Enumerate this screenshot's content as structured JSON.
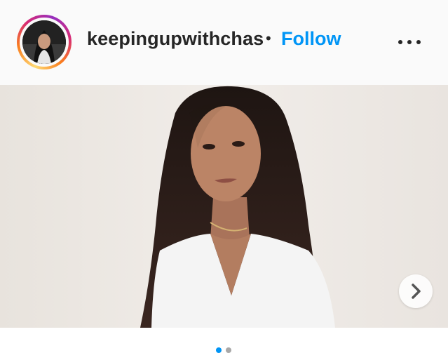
{
  "post": {
    "username": "keepingupwithchas",
    "separator": "•",
    "follow_label": "Follow",
    "more_icon": "more-options-icon",
    "next_icon": "chevron-right-icon"
  },
  "carousel": {
    "slide_count": 2,
    "active_index": 0,
    "active_color": "#0095f6",
    "inactive_color": "#a8a8a8"
  },
  "colors": {
    "follow": "#0095f6",
    "text": "#262626",
    "header_bg": "#fafafa"
  }
}
